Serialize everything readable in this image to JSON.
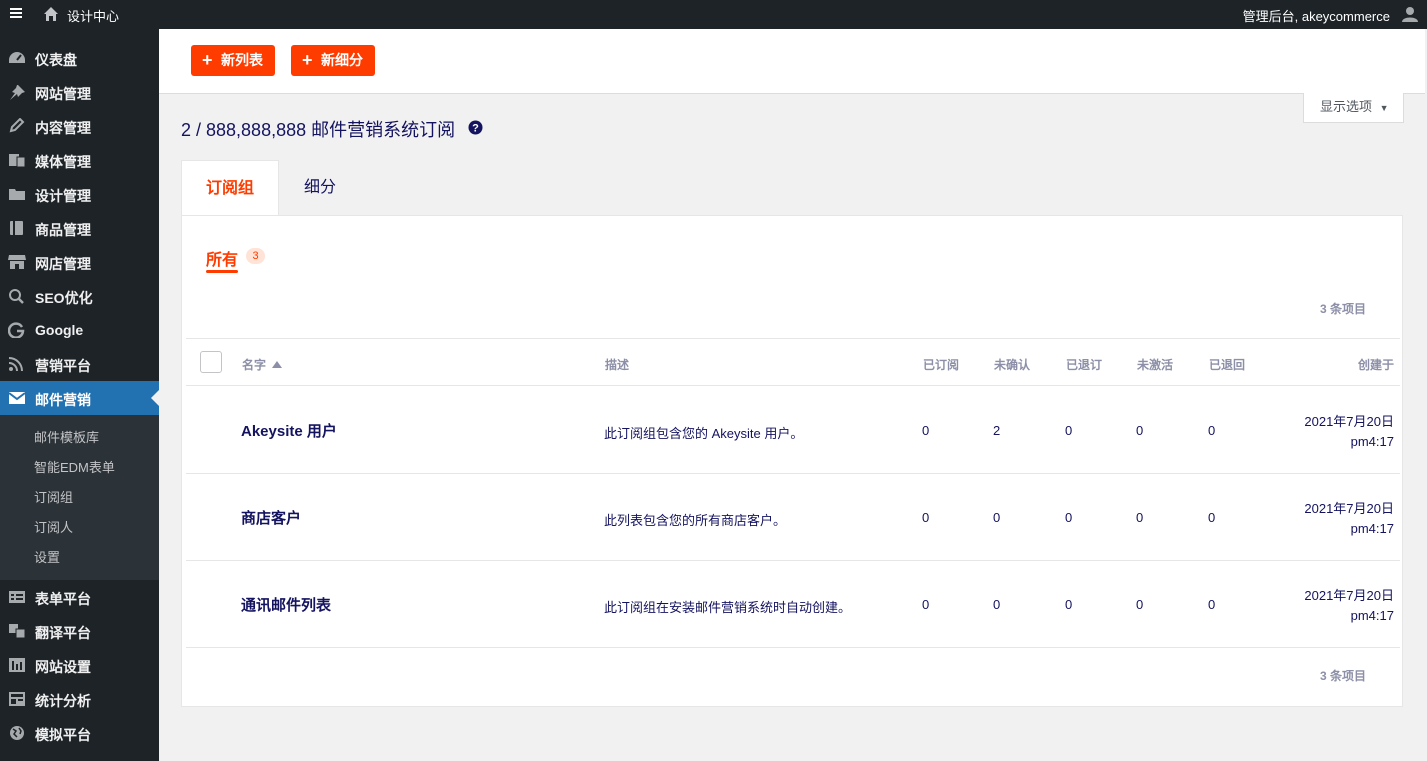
{
  "adminbar": {
    "site_name": "设计中心",
    "account": "管理后台, akeycommerce"
  },
  "sidebar": {
    "items": [
      {
        "label": "仪表盘",
        "icon": "dashboard-icon"
      },
      {
        "label": "网站管理",
        "icon": "pin-icon"
      },
      {
        "label": "内容管理",
        "icon": "pencil-icon"
      },
      {
        "label": "媒体管理",
        "icon": "media-icon"
      },
      {
        "label": "设计管理",
        "icon": "folder-icon"
      },
      {
        "label": "商品管理",
        "icon": "book-icon"
      },
      {
        "label": "网店管理",
        "icon": "store-icon"
      },
      {
        "label": "SEO优化",
        "icon": "search-icon"
      },
      {
        "label": "Google",
        "icon": "google-icon"
      },
      {
        "label": "营销平台",
        "icon": "rss-icon"
      },
      {
        "label": "邮件营销",
        "icon": "mail-icon"
      }
    ],
    "submenu": [
      "邮件模板库",
      "智能EDM表单",
      "订阅组",
      "订阅人",
      "设置"
    ],
    "items_bottom": [
      {
        "label": "表单平台",
        "icon": "form-icon"
      },
      {
        "label": "翻译平台",
        "icon": "translate-icon"
      },
      {
        "label": "网站设置",
        "icon": "settings-icon"
      },
      {
        "label": "统计分析",
        "icon": "analytics-icon"
      },
      {
        "label": "模拟平台",
        "icon": "globe-icon"
      }
    ]
  },
  "toolbar": {
    "new_list": "新列表",
    "new_segment": "新细分",
    "screen_options": "显示选项"
  },
  "page": {
    "title": "2 / 888,888,888 邮件营销系统订阅"
  },
  "tabs": [
    "订阅组",
    "细分"
  ],
  "filter": {
    "all_label": "所有",
    "all_count": "3"
  },
  "items_count": "3 条项目",
  "table": {
    "headers": [
      "名字",
      "描述",
      "已订阅",
      "未确认",
      "已退订",
      "未激活",
      "已退回",
      "创建于"
    ],
    "rows": [
      {
        "name": "Akeysite 用户",
        "desc": "此订阅组包含您的 Akeysite 用户。",
        "subscribed": "0",
        "unconfirmed": "2",
        "unsubscribed": "0",
        "inactive": "0",
        "bounced": "0",
        "date": "2021年7月20日",
        "time": "pm4:17"
      },
      {
        "name": "商店客户",
        "desc": "此列表包含您的所有商店客户。",
        "subscribed": "0",
        "unconfirmed": "0",
        "unsubscribed": "0",
        "inactive": "0",
        "bounced": "0",
        "date": "2021年7月20日",
        "time": "pm4:17"
      },
      {
        "name": "通讯邮件列表",
        "desc": "此订阅组在安装邮件营销系统时自动创建。",
        "subscribed": "0",
        "unconfirmed": "0",
        "unsubscribed": "0",
        "inactive": "0",
        "bounced": "0",
        "date": "2021年7月20日",
        "time": "pm4:17"
      }
    ]
  },
  "colors": {
    "accent": "#ff3c00",
    "sidebar_bg": "#1d2327",
    "active_blue": "#2271b1",
    "text_navy": "#14135f"
  }
}
